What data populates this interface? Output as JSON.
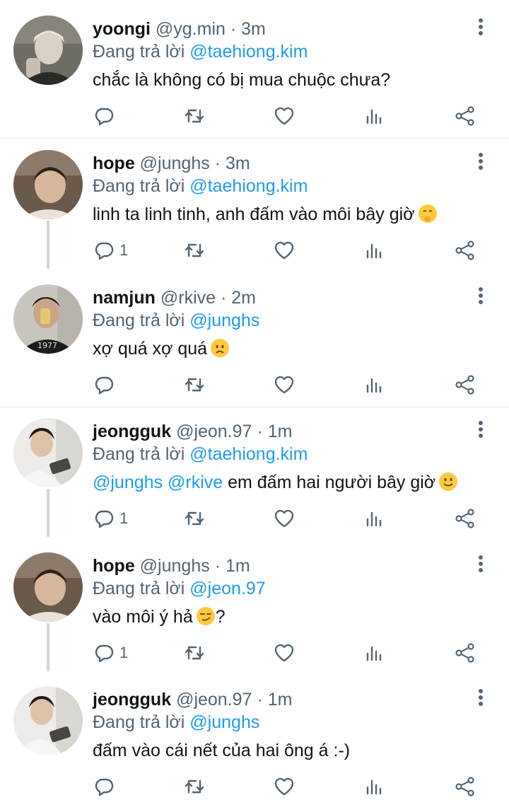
{
  "replying_to_label": "Đang trả lời",
  "tweets": [
    {
      "name": "yoongi",
      "handle": "@yg.min",
      "dot": "·",
      "time": "3m",
      "reply_to": "@taehiong.kim",
      "text_mentions": "",
      "text": "chắc là không có bị mua chuộc chưa?",
      "emoji": "",
      "emoji_after": "",
      "reply_count": ""
    },
    {
      "name": "hope",
      "handle": "@junghs",
      "dot": "·",
      "time": "3m",
      "reply_to": "@taehiong.kim",
      "text_mentions": "",
      "text": "linh ta linh tinh, anh đấm vào môi bây giờ",
      "emoji": "shushing-face",
      "emoji_after": "",
      "reply_count": "1"
    },
    {
      "name": "namjun",
      "handle": "@rkive",
      "dot": "·",
      "time": "2m",
      "reply_to": "@junghs",
      "text_mentions": "",
      "text": "xợ quá xợ quá",
      "emoji": "worried-face",
      "emoji_after": "",
      "reply_count": ""
    },
    {
      "name": "jeongguk",
      "handle": "@jeon.97",
      "dot": "·",
      "time": "1m",
      "reply_to": "@taehiong.kim",
      "text_mentions": "@junghs @rkive",
      "text": " em đấm hai người bây giờ",
      "emoji": "slightly-smiling-face",
      "emoji_after": "",
      "reply_count": "1"
    },
    {
      "name": "hope",
      "handle": "@junghs",
      "dot": "·",
      "time": "1m",
      "reply_to": "@jeon.97",
      "text_mentions": "",
      "text": "vào môi ý hả",
      "emoji": "smirking-face",
      "emoji_after": "?",
      "reply_count": "1"
    },
    {
      "name": "jeongguk",
      "handle": "@jeon.97",
      "dot": "·",
      "time": "1m",
      "reply_to": "@junghs",
      "text_mentions": "",
      "text": "đấm vào cái nết của hai ông á :-)",
      "emoji": "",
      "emoji_after": "",
      "reply_count": ""
    }
  ],
  "icons": {
    "reply": "reply-icon",
    "retweet": "retweet-icon",
    "like": "heart-icon",
    "stats": "stats-icon",
    "share": "share-icon",
    "more": "more-vertical-icon"
  },
  "colors": {
    "mention": "#1d9bf0",
    "secondary": "#536471",
    "thread_line": "#cfd9de"
  }
}
